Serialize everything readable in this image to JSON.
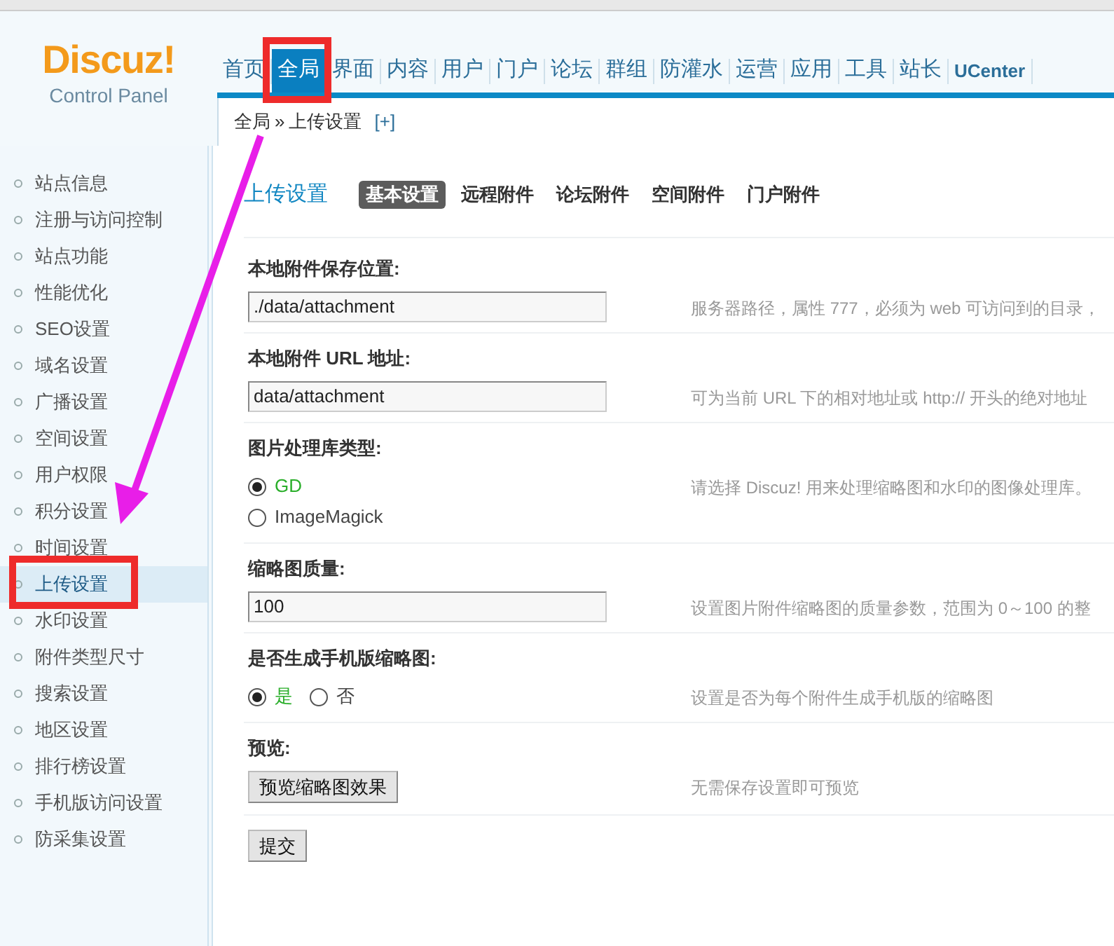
{
  "logo": {
    "name": "Discuz!",
    "subtitle": "Control Panel"
  },
  "nav": [
    {
      "label": "首页",
      "selected": false
    },
    {
      "label": "全局",
      "selected": true
    },
    {
      "label": "界面",
      "selected": false
    },
    {
      "label": "内容",
      "selected": false
    },
    {
      "label": "用户",
      "selected": false
    },
    {
      "label": "门户",
      "selected": false
    },
    {
      "label": "论坛",
      "selected": false
    },
    {
      "label": "群组",
      "selected": false
    },
    {
      "label": "防灌水",
      "selected": false
    },
    {
      "label": "运营",
      "selected": false
    },
    {
      "label": "应用",
      "selected": false
    },
    {
      "label": "工具",
      "selected": false
    },
    {
      "label": "站长",
      "selected": false
    },
    {
      "label": "UCenter",
      "selected": false
    }
  ],
  "breadcrumb": {
    "items": [
      "全局",
      "上传设置"
    ],
    "separator": "»",
    "add": "[+]"
  },
  "sidebar": [
    {
      "label": "站点信息",
      "selected": false
    },
    {
      "label": "注册与访问控制",
      "selected": false
    },
    {
      "label": "站点功能",
      "selected": false
    },
    {
      "label": "性能优化",
      "selected": false
    },
    {
      "label": "SEO设置",
      "selected": false
    },
    {
      "label": "域名设置",
      "selected": false
    },
    {
      "label": "广播设置",
      "selected": false
    },
    {
      "label": "空间设置",
      "selected": false
    },
    {
      "label": "用户权限",
      "selected": false
    },
    {
      "label": "积分设置",
      "selected": false
    },
    {
      "label": "时间设置",
      "selected": false
    },
    {
      "label": "上传设置",
      "selected": true
    },
    {
      "label": "水印设置",
      "selected": false
    },
    {
      "label": "附件类型尺寸",
      "selected": false
    },
    {
      "label": "搜索设置",
      "selected": false
    },
    {
      "label": "地区设置",
      "selected": false
    },
    {
      "label": "排行榜设置",
      "selected": false
    },
    {
      "label": "手机版访问设置",
      "selected": false
    },
    {
      "label": "防采集设置",
      "selected": false
    }
  ],
  "page": {
    "title": "上传设置",
    "tabs": [
      {
        "label": "基本设置",
        "selected": true
      },
      {
        "label": "远程附件",
        "selected": false
      },
      {
        "label": "论坛附件",
        "selected": false
      },
      {
        "label": "空间附件",
        "selected": false
      },
      {
        "label": "门户附件",
        "selected": false
      }
    ]
  },
  "settings": [
    {
      "kind": "text",
      "label": "本地附件保存位置:",
      "value": "./data/attachment",
      "hint": "服务器路径，属性 777，必须为 web 可访问到的目录，"
    },
    {
      "kind": "text",
      "label": "本地附件 URL 地址:",
      "value": "data/attachment",
      "hint": "可为当前 URL 下的相对地址或 http:// 开头的绝对地址"
    },
    {
      "kind": "radiolist",
      "label": "图片处理库类型:",
      "options": [
        {
          "label": "GD",
          "selected": true
        },
        {
          "label": "ImageMagick",
          "selected": false
        }
      ],
      "hint": "请选择 Discuz! 用来处理缩略图和水印的图像处理库。"
    },
    {
      "kind": "text",
      "label": "缩略图质量:",
      "value": "100",
      "hint": "设置图片附件缩略图的质量参数，范围为 0～100 的整"
    },
    {
      "kind": "radiorow",
      "label": "是否生成手机版缩略图:",
      "options": [
        {
          "label": "是",
          "selected": true
        },
        {
          "label": "否",
          "selected": false
        }
      ],
      "hint": "设置是否为每个附件生成手机版的缩略图"
    },
    {
      "kind": "button",
      "label": "预览:",
      "button": "预览缩略图效果",
      "hint": "无需保存设置即可预览"
    }
  ],
  "submit": "提交"
}
